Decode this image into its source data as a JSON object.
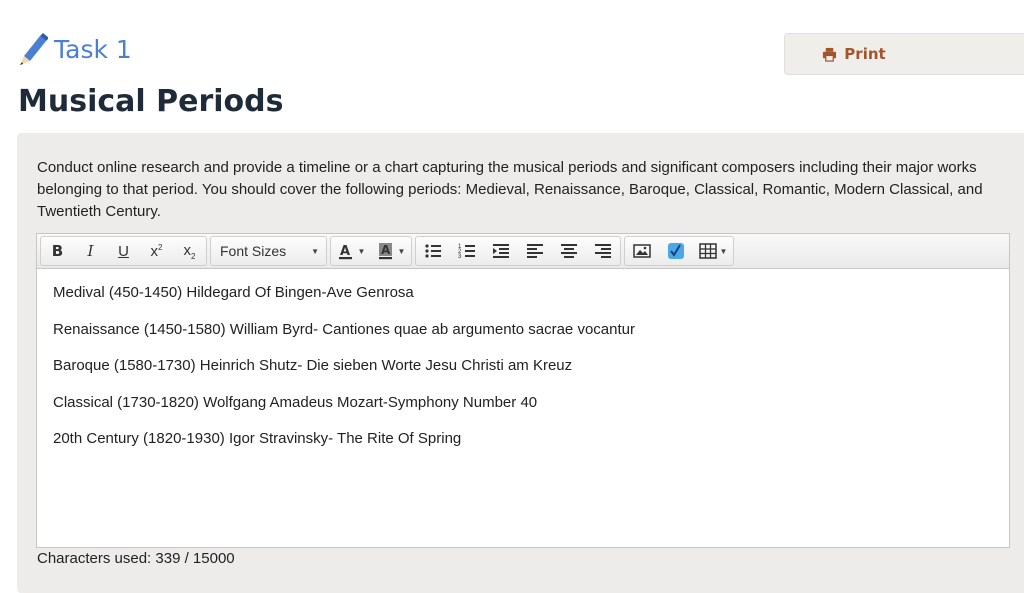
{
  "header": {
    "task_label": "Task 1"
  },
  "print_button": {
    "label": "Print"
  },
  "page": {
    "title": "Musical Periods"
  },
  "instructions": "Conduct online research and provide a timeline or a chart capturing the musical periods and significant composers including their major works belonging to that period. You should cover the following periods: Medieval, Renaissance, Baroque, Classical, Romantic, Modern Classical, and Twentieth Century.",
  "toolbar": {
    "font_sizes_label": "Font Sizes",
    "icons": [
      "bold-icon",
      "italic-icon",
      "underline-icon",
      "superscript-icon",
      "subscript-icon",
      "text-color-icon",
      "background-color-icon",
      "bullet-list-icon",
      "numbered-list-icon",
      "indent-icon",
      "align-left-icon",
      "align-center-icon",
      "align-right-icon",
      "image-icon",
      "equation-icon",
      "table-icon"
    ]
  },
  "editor": {
    "lines": [
      "Medival (450-1450) Hildegard Of Bingen-Ave Genrosa",
      "Renaissance (1450-1580) William Byrd- Cantiones quae ab argumento sacrae vocantur",
      "Baroque (1580-1730) Heinrich Shutz- Die sieben Worte Jesu Christi am Kreuz",
      "Classical (1730-1820) Wolfgang Amadeus Mozart-Symphony Number 40",
      "20th Century (1820-1930) Igor Stravinsky- The Rite Of Spring"
    ]
  },
  "footer": {
    "char_count": "Characters used: 339 / 15000"
  },
  "colors": {
    "task_blue": "#4a7fd4",
    "print_brown": "#a4552a",
    "title_dark": "#1f2b38",
    "panel_bg": "#eeecea"
  }
}
